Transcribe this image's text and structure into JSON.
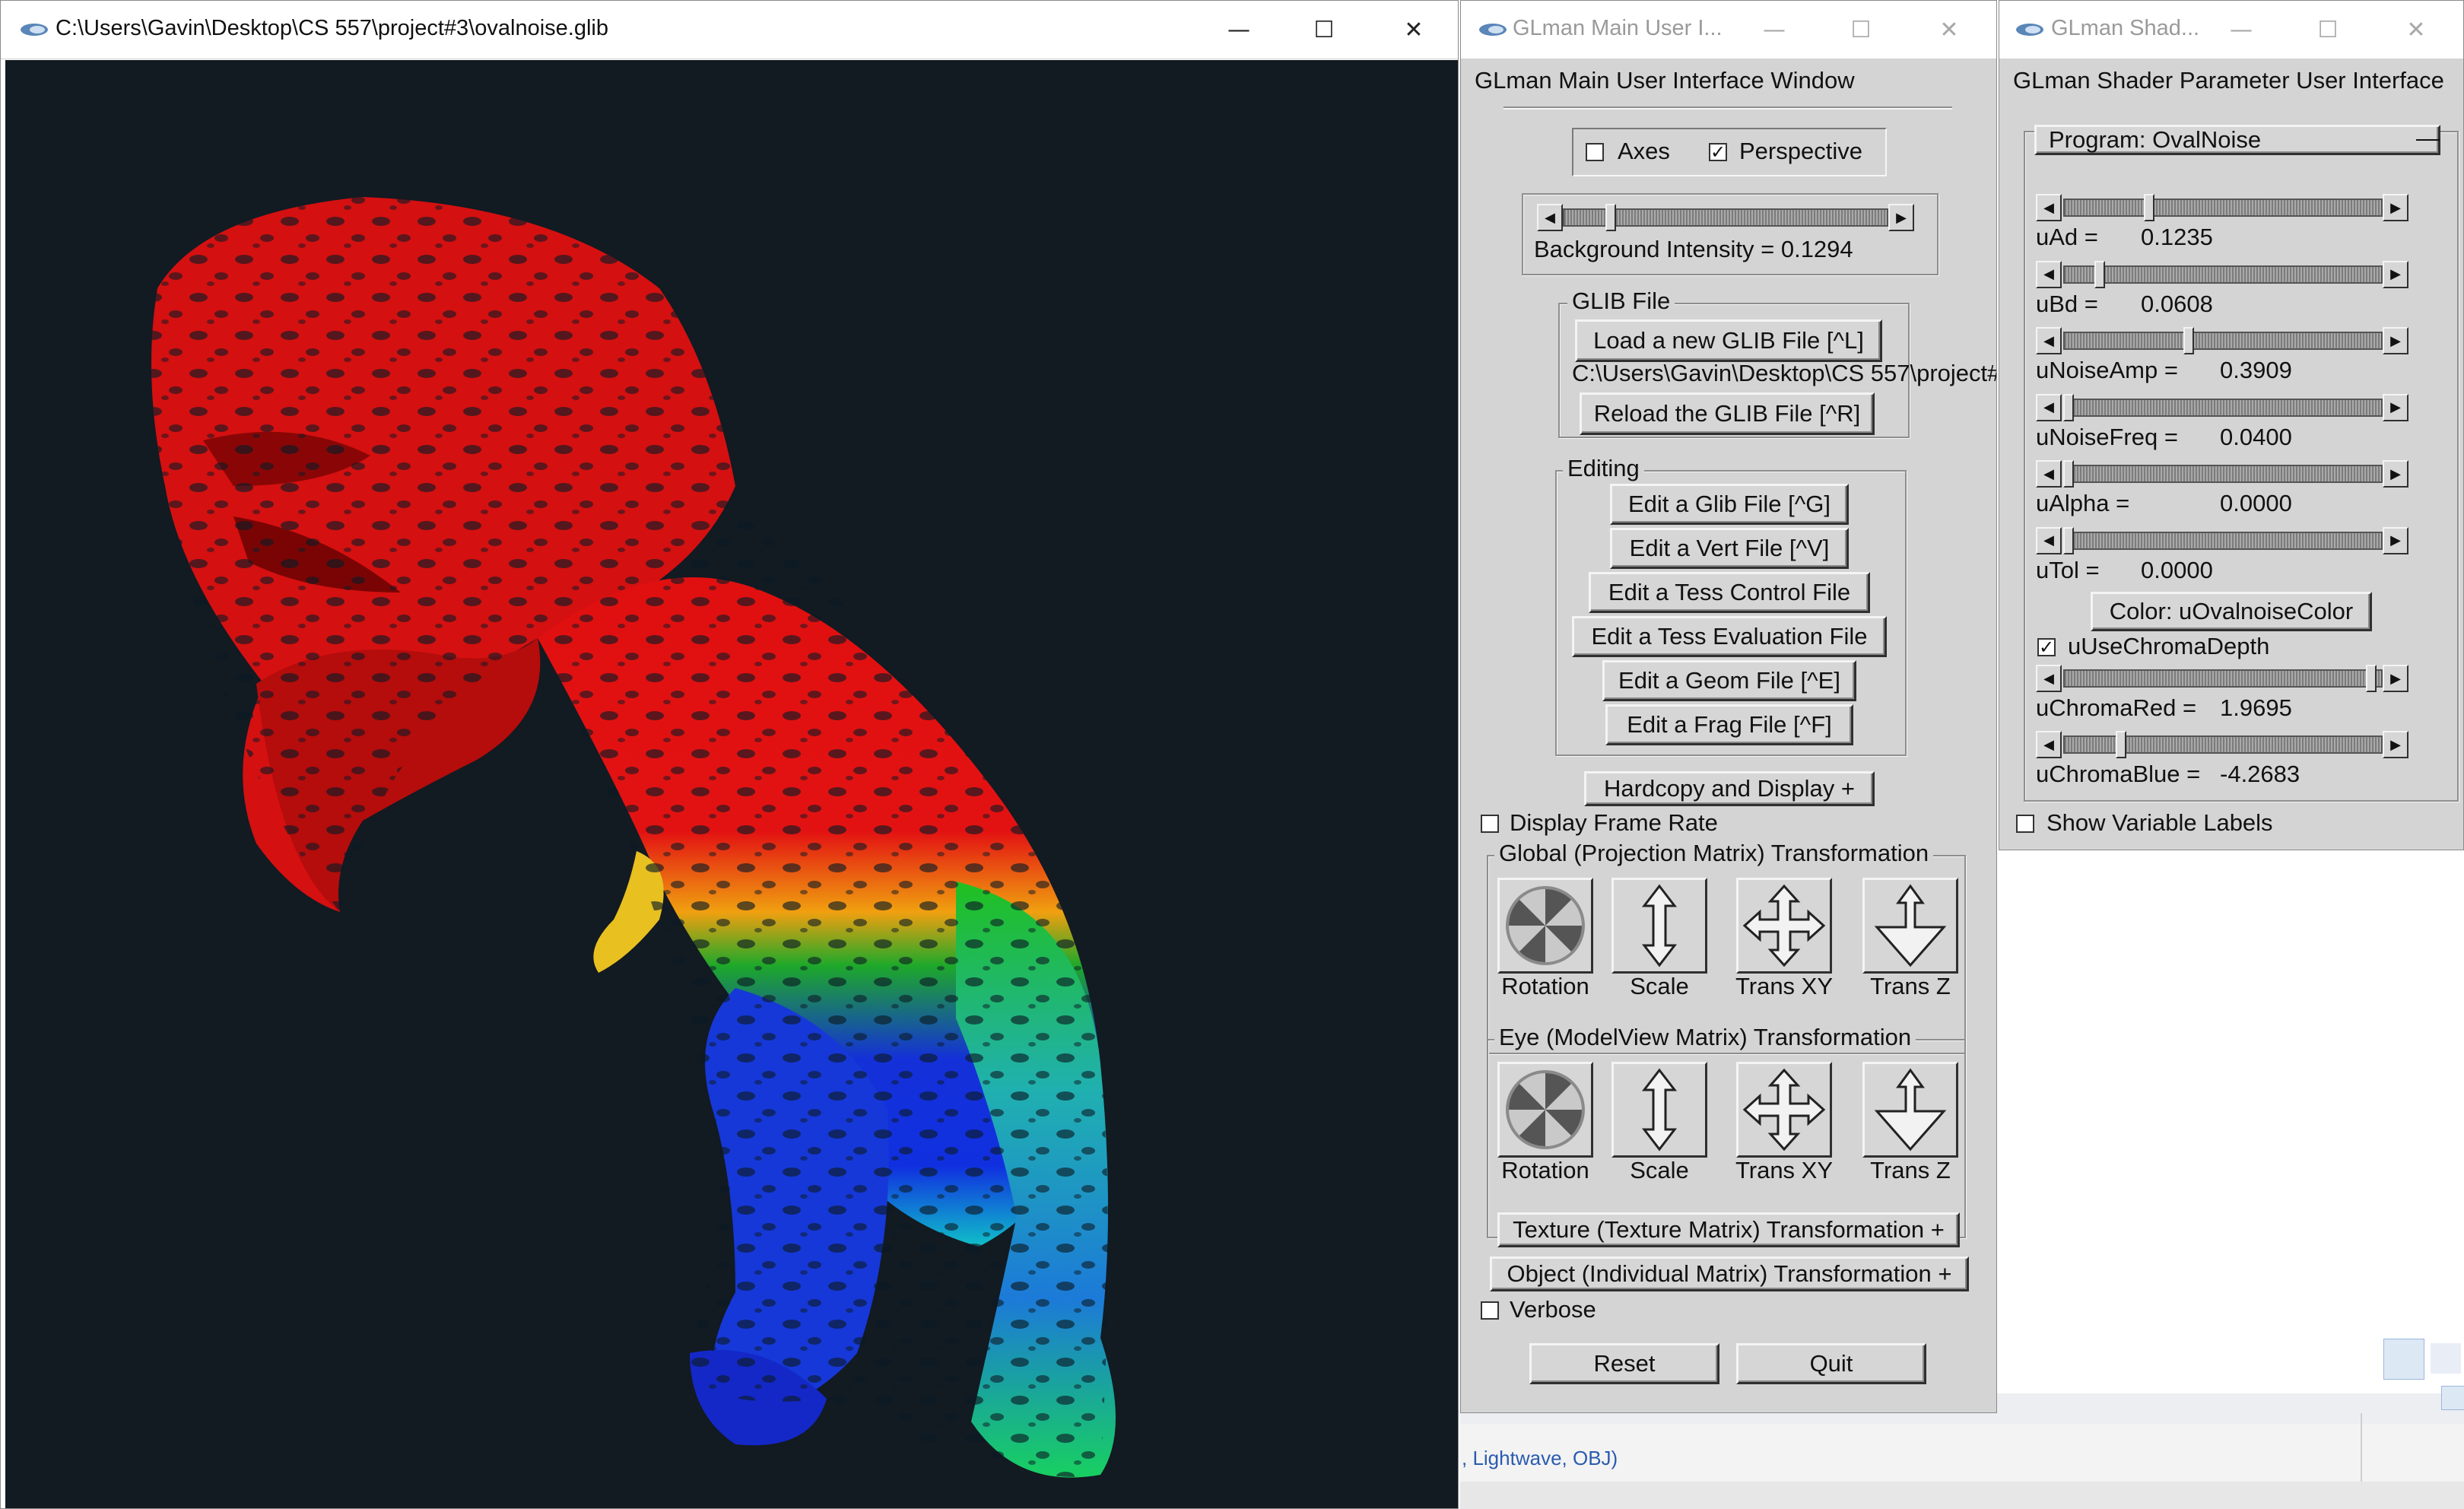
{
  "viewport_window": {
    "title": "C:\\Users\\Gavin\\Desktop\\CS 557\\project#3\\ovalnoise.glib",
    "bg_color": "#121a22"
  },
  "main_window": {
    "title": "GLman Main User I...",
    "header": "GLman Main User Interface Window",
    "axes_label": "Axes",
    "axes_checked": false,
    "perspective_label": "Perspective",
    "perspective_checked": true,
    "background_intensity_label": "Background Intensity = 0.1294",
    "background_intensity_value": 0.1294,
    "glib_group": {
      "label": "GLIB File",
      "load_button": "Load a new GLIB File [^L]",
      "path": "C:\\Users\\Gavin\\Desktop\\CS 557\\project#",
      "reload_button": "Reload the GLIB File [^R]"
    },
    "editing_group": {
      "label": "Editing",
      "buttons": [
        "Edit a Glib File [^G]",
        "Edit a Vert File [^V]",
        "Edit a Tess Control File",
        "Edit a Tess Evaluation File",
        "Edit a Geom File [^E]",
        "Edit a Frag File [^F]"
      ]
    },
    "hardcopy_button": "Hardcopy and Display +",
    "display_frame_rate_label": "Display Frame Rate",
    "global_group": {
      "label": "Global (Projection Matrix) Transformation",
      "controls": [
        "Rotation",
        "Scale",
        "Trans XY",
        "Trans Z"
      ]
    },
    "eye_group": {
      "label": "Eye (ModelView Matrix) Transformation",
      "controls": [
        "Rotation",
        "Scale",
        "Trans XY",
        "Trans Z"
      ]
    },
    "texture_button": "Texture (Texture Matrix) Transformation +",
    "object_button": "Object (Individual Matrix) Transformation +",
    "verbose_label": "Verbose",
    "reset_button": "Reset",
    "quit_button": "Quit"
  },
  "shader_window": {
    "title": "GLman Shad...",
    "header": "GLman Shader Parameter User Interface",
    "program_label": "Program: OvalNoise",
    "program_toggle": "—",
    "params": [
      {
        "name": "uAd =",
        "value": "0.1235",
        "fraction": 0.26
      },
      {
        "name": "uBd =",
        "value": "0.0608",
        "fraction": 0.1
      },
      {
        "name": "uNoiseAmp =",
        "value": "0.3909",
        "fraction": 0.39
      },
      {
        "name": "uNoiseFreq =",
        "value": "0.0400",
        "fraction": 0.0
      },
      {
        "name": "uAlpha =",
        "value": "0.0000",
        "fraction": 0.0
      },
      {
        "name": "uTol =",
        "value": "0.0000",
        "fraction": 0.0
      }
    ],
    "color_button": "Color: uOvalnoiseColor",
    "use_chroma_label": "uUseChromaDepth",
    "use_chroma_checked": true,
    "chroma_params": [
      {
        "name": "uChromaRed =",
        "value": "1.9695",
        "fraction": 0.98
      },
      {
        "name": "uChromaBlue =",
        "value": "-4.2683",
        "fraction": 0.17
      }
    ],
    "show_labels": "Show Variable Labels"
  },
  "background_app": {
    "status_text": ", Lightwave, OBJ)"
  }
}
